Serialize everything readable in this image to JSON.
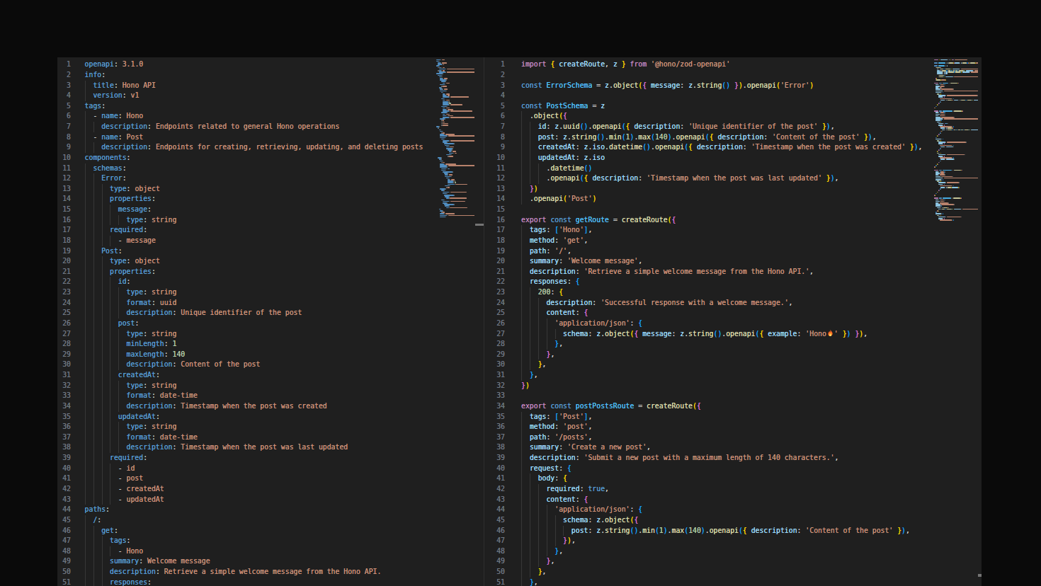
{
  "theme": {
    "outer_background": "#0a0a0a",
    "editor_background": "#1f1f1f",
    "divider": "#2e2e2e",
    "line_number": "#6e7681",
    "indent_guide": "#373737",
    "foreground": "#cccccc",
    "yaml_key": "#569cd6",
    "keyword": "#c586c0",
    "keyword_const": "#569cd6",
    "const_name": "#4fc1ff",
    "property": "#9cdcfe",
    "function": "#dcdcaa",
    "string": "#ce9178",
    "number": "#b5cea8",
    "bracket_colors": [
      "#ffd700",
      "#da70d6",
      "#179fff"
    ],
    "overview_cursor_marker": "#747474"
  },
  "editors": {
    "left": {
      "language": "yaml",
      "lines": [
        "openapi: 3.1.0",
        "info:",
        "  title: Hono API",
        "  version: v1",
        "tags:",
        "  - name: Hono",
        "    description: Endpoints related to general Hono operations",
        "  - name: Post",
        "    description: Endpoints for creating, retrieving, updating, and deleting posts",
        "components:",
        "  schemas:",
        "    Error:",
        "      type: object",
        "      properties:",
        "        message:",
        "          type: string",
        "      required:",
        "        - message",
        "    Post:",
        "      type: object",
        "      properties:",
        "        id:",
        "          type: string",
        "          format: uuid",
        "          description: Unique identifier of the post",
        "        post:",
        "          type: string",
        "          minLength: 1",
        "          maxLength: 140",
        "          description: Content of the post",
        "        createdAt:",
        "          type: string",
        "          format: date-time",
        "          description: Timestamp when the post was created",
        "        updatedAt:",
        "          type: string",
        "          format: date-time",
        "          description: Timestamp when the post was last updated",
        "      required:",
        "        - id",
        "        - post",
        "        - createdAt",
        "        - updatedAt",
        "paths:",
        "  /:",
        "    get:",
        "      tags:",
        "        - Hono",
        "      summary: Welcome message",
        "      description: Retrieve a simple welcome message from the Hono API.",
        "      responses:"
      ],
      "minimap_extra_lines": [
        "        '200':",
        "          description: Successful response with a welcome message.",
        "          content:",
        "            application/json:",
        "              schema:",
        "                type: object",
        "                properties:",
        "                  message:",
        "                    type: string",
        "                    example: Hono",
        "                required:",
        "                  - message",
        "  /posts:",
        "    post:",
        "      tags:",
        "        - Post",
        "      summary: Create a new post",
        "      description: Submit a new post with a maximum length of 140 characters.",
        "      requestBody:",
        "        required: true",
        "        content:",
        "          application/json:",
        "            schema:",
        "              type: object",
        "              properties:",
        "                post:",
        "                  type: string",
        "                  minLength: 1",
        "                  maxLength: 140",
        "                  description: Content of the post",
        "              required:",
        "                - post",
        "      responses:",
        "        '201':",
        "          description: Post created successfully.",
        "          content:",
        "            application/json:",
        "              schema:",
        "                $ref: '#/components/schemas/Post'",
        "        '400':",
        "          description: Invalid request payload.",
        "          content:",
        "            application/json:",
        "              schema:",
        "                $ref: '#/components/schemas/Error'",
        "    get:",
        "      tags:",
        "        - Post",
        "      summary: List all posts",
        "      description: Retrieve all posts in reverse chronological order.",
        "      responses:",
        "        '200':",
        "          description: A list of posts.",
        "          content:",
        "            application/json:",
        "              schema:",
        "                type: array",
        "                items:",
        "                  $ref: '#/components/schemas/Post'",
        "  /posts/{id}:",
        "    get:",
        "      tags:",
        "        - Post",
        "      summary: Get a post by ID",
        "      description: Retrieve a single post by its unique identifier.",
        "      parameters:",
        "        - name: id",
        "          in: path",
        "          required: true",
        "          schema:",
        "            type: string",
        "            format: uuid",
        "      responses:",
        "        '200':",
        "          description: The requested post.",
        "          content:",
        "            application/json:",
        "              schema:",
        "                $ref: '#/components/schemas/Post'",
        "        '404':",
        "          description: Post not found.",
        "          content:",
        "            application/json:",
        "              schema:",
        "                $ref: '#/components/schemas/Error'",
        "    put:",
        "      tags:",
        "        - Post",
        "      summary: Update a post",
        "      description: Update the content of an existing post.",
        "      parameters:",
        "        - name: id",
        "          in: path",
        "          required: true"
      ]
    },
    "right": {
      "language": "typescript",
      "lines": [
        "import { createRoute, z } from '@hono/zod-openapi'",
        "",
        "const ErrorSchema = z.object({ message: z.string() }).openapi('Error')",
        "",
        "const PostSchema = z",
        "  .object({",
        "    id: z.uuid().openapi({ description: 'Unique identifier of the post' }),",
        "    post: z.string().min(1).max(140).openapi({ description: 'Content of the post' }),",
        "    createdAt: z.iso.datetime().openapi({ description: 'Timestamp when the post was created' }),",
        "    updatedAt: z.iso",
        "      .datetime()",
        "      .openapi({ description: 'Timestamp when the post was last updated' }),",
        "  })",
        "  .openapi('Post')",
        "",
        "export const getRoute = createRoute({",
        "  tags: ['Hono'],",
        "  method: 'get',",
        "  path: '/',",
        "  summary: 'Welcome message',",
        "  description: 'Retrieve a simple welcome message from the Hono API.',",
        "  responses: {",
        "    200: {",
        "      description: 'Successful response with a welcome message.',",
        "      content: {",
        "        'application/json': {",
        "          schema: z.object({ message: z.string().openapi({ example: 'Hono🔥' }) }),",
        "        },",
        "      },",
        "    },",
        "  },",
        "})",
        "",
        "export const postPostsRoute = createRoute({",
        "  tags: ['Post'],",
        "  method: 'post',",
        "  path: '/posts',",
        "  summary: 'Create a new post',",
        "  description: 'Submit a new post with a maximum length of 140 characters.',",
        "  request: {",
        "    body: {",
        "      required: true,",
        "      content: {",
        "        'application/json': {",
        "          schema: z.object({",
        "            post: z.string().min(1).max(140).openapi({ description: 'Content of the post' }),",
        "          }),",
        "        },",
        "      },",
        "    },",
        "  },"
      ],
      "minimap_extra_lines": [
        "  responses: {",
        "    201: {",
        "      description: 'Post created successfully.',",
        "      content: {",
        "        'application/json': {",
        "          schema: PostSchema,",
        "        },",
        "      },",
        "    },",
        "    400: {",
        "      description: 'Invalid request payload.',",
        "      content: {",
        "        'application/json': {",
        "          schema: ErrorSchema,",
        "        },",
        "      },",
        "    },",
        "  },",
        "})",
        "",
        "export const getPostsRoute = createRoute({",
        "  tags: ['Post'],",
        "  method: 'get',",
        "  path: '/posts',",
        "  summary: 'List all posts',",
        "  description: 'Retrieve all posts in reverse chronological order.',",
        "  responses: {",
        "    200: {",
        "      description: 'A list of posts.',",
        "      content: {",
        "        'application/json': {",
        "          schema: z.array(PostSchema),",
        "        },",
        "      },",
        "    },",
        "  },",
        "})",
        "",
        "export const getPostRoute = createRoute({",
        "  tags: ['Post'],",
        "  method: 'get',",
        "  path: '/posts/{id}',",
        "  summary: 'Get a post by ID',",
        "  request: {",
        "    params: z.object({",
        "      id: z.uuid().openapi({ description: 'Unique identifier of the post' }),",
        "    }),",
        "  },",
        "  responses: {",
        "    200: {",
        "      description: 'The requested post.',",
        "      content: {",
        "        'application/json': {"
      ]
    }
  }
}
